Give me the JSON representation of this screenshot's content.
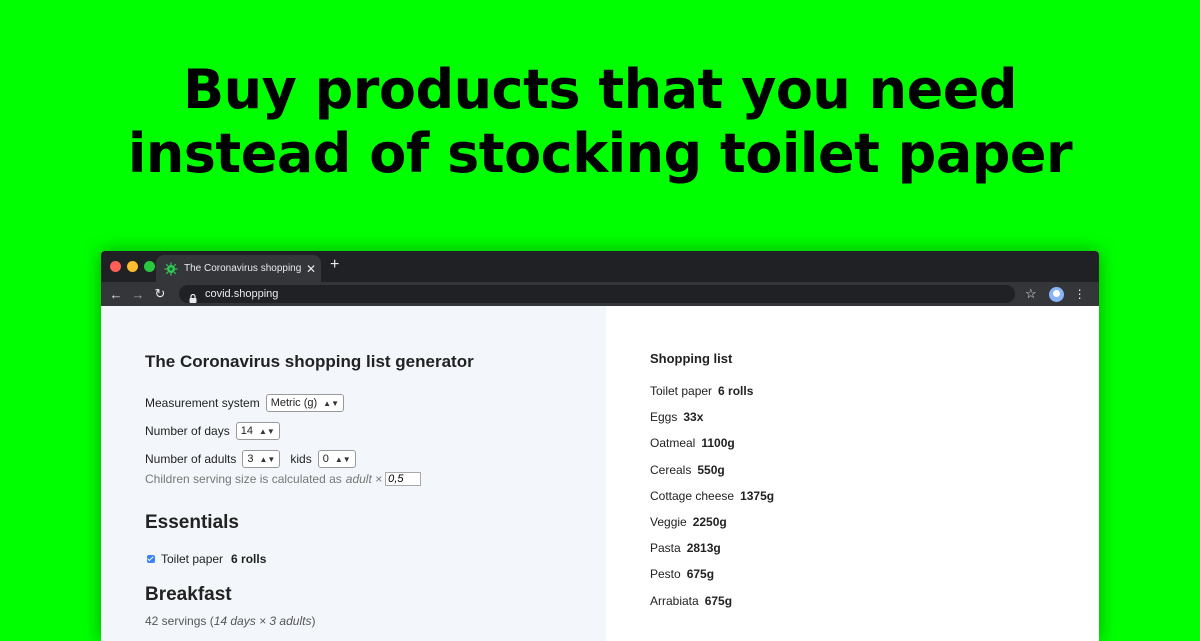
{
  "headline": {
    "line1": "Buy products that you need",
    "line2": "instead of stocking toilet paper"
  },
  "browser": {
    "tab_title": "The Coronavirus shopping list ge",
    "url": "covid.shopping",
    "icons": [
      "back-arrow-icon",
      "forward-arrow-icon",
      "reload-icon",
      "lock-icon",
      "star-icon",
      "profile-avatar",
      "menu-dots-icon"
    ]
  },
  "form": {
    "title": "The Coronavirus shopping list generator",
    "measurement_label": "Measurement system",
    "measurement_value": "Metric (g)",
    "days_label": "Number of days",
    "days_value": "14",
    "adults_label": "Number of adults",
    "adults_value": "3",
    "kids_label": "kids",
    "kids_value": "0",
    "hint_text": "Children serving size is calculated as",
    "hint_italic": "adult ×",
    "hint_value": "0,5"
  },
  "essentials": {
    "title": "Essentials",
    "item_label": "Toilet paper",
    "item_amount": "6 rolls"
  },
  "breakfast": {
    "title": "Breakfast",
    "servings_prefix": "42 servings (",
    "servings_italic": "14 days × 3 adults",
    "servings_suffix": ")"
  },
  "shopping": {
    "title": "Shopping list",
    "items": [
      {
        "name": "Toilet paper",
        "amount": "6 rolls"
      },
      {
        "name": "Eggs",
        "amount": "33x"
      },
      {
        "name": "Oatmeal",
        "amount": "1100g"
      },
      {
        "name": "Cereals",
        "amount": "550g"
      },
      {
        "name": "Cottage cheese",
        "amount": "1375g"
      },
      {
        "name": "Veggie",
        "amount": "2250g"
      },
      {
        "name": "Pasta",
        "amount": "2813g"
      },
      {
        "name": "Pesto",
        "amount": "675g"
      },
      {
        "name": "Arrabiata",
        "amount": "675g"
      }
    ]
  },
  "colors": {
    "background": "#00ff00",
    "left_panel": "#f3f7fb",
    "checkbox": "#3b82f6"
  }
}
